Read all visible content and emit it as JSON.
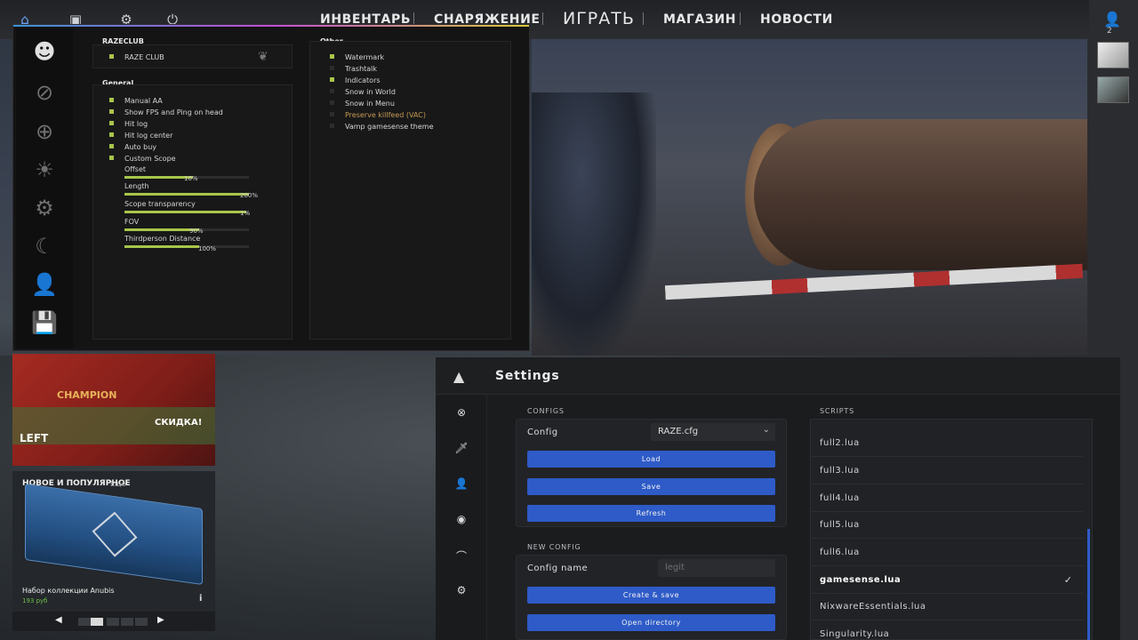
{
  "topnav": {
    "icons": [
      "home-icon",
      "tv-icon",
      "gear-icon",
      "power-icon"
    ],
    "items": [
      "ИНВЕНТАРЬ",
      "СНАРЯЖЕНИЕ",
      "ИГРАТЬ",
      "МАГАЗИН",
      "НОВОСТИ"
    ]
  },
  "friends": {
    "count": "2"
  },
  "menu": {
    "group_razeclub": {
      "title": "RAZECLUB",
      "items": [
        "RAZE CLUB"
      ]
    },
    "group_general": {
      "title": "General",
      "checkboxes": [
        "Manual AA",
        "Show FPS and Ping on head",
        "Hit log",
        "Hit log center",
        "Auto buy",
        "Custom Scope"
      ],
      "sliders": [
        {
          "label": "Offset",
          "value_text": "10%",
          "value": 0.55
        },
        {
          "label": "Length",
          "value_text": "200%",
          "value": 1.0
        },
        {
          "label": "Scope transparency",
          "value_text": "1%",
          "value": 0.98
        },
        {
          "label": "FOV",
          "value_text": "90%",
          "value": 0.6
        },
        {
          "label": "Thirdperson Distance",
          "value_text": "100%",
          "value": 0.6
        }
      ]
    },
    "group_other": {
      "title": "Other",
      "items": [
        {
          "label": "Watermark",
          "on": true
        },
        {
          "label": "Trashtalk",
          "on": false
        },
        {
          "label": "Indicators",
          "on": true
        },
        {
          "label": "Snow in World",
          "on": false
        },
        {
          "label": "Snow in Menu",
          "on": false
        },
        {
          "label": "Preserve killfeed (VAC)",
          "on": false,
          "warn": true
        },
        {
          "label": "Vamp gamesense theme",
          "on": false
        }
      ]
    }
  },
  "promo": {
    "champion": "CHAMPION",
    "sale": "СКИДКА!",
    "left": "LEFT"
  },
  "store": {
    "heading": "НОВОЕ И ПОПУЛЯРНОЕ",
    "more": "Ещё",
    "item_name": "Набор коллекции Anubis",
    "item_price": "193 руб",
    "info": "i"
  },
  "settings": {
    "title": "Settings",
    "configs_label": "CONFIGS",
    "config_field": "Config",
    "config_value": "RAZE.cfg",
    "load": "Load",
    "save": "Save",
    "refresh": "Refresh",
    "new_config_label": "NEW CONFIG",
    "config_name_field": "Config name",
    "config_name_placeholder": "legit",
    "create_save": "Create & save",
    "open_directory": "Open directory",
    "scripts_label": "SCRIPTS",
    "scripts": [
      "full2.lua",
      "full3.lua",
      "full4.lua",
      "full5.lua",
      "full6.lua",
      "gamesense.lua",
      "NixwareEssentials.lua",
      "Singularity.lua"
    ],
    "selected_script": "gamesense.lua"
  }
}
